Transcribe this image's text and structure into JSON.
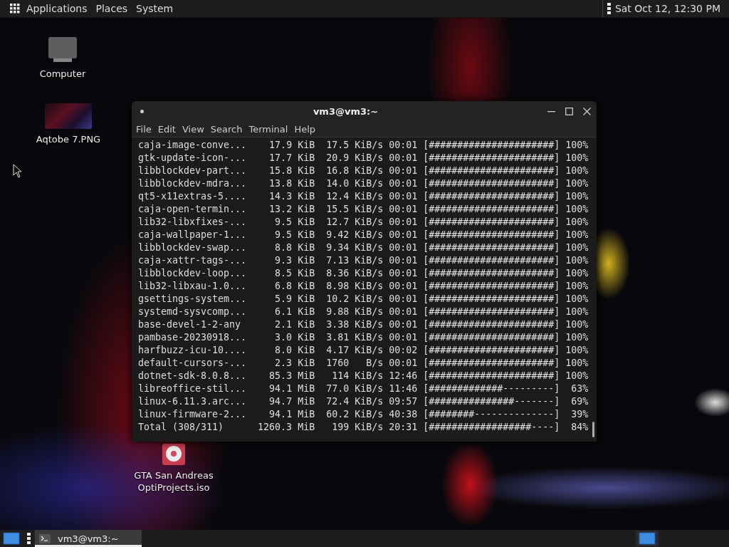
{
  "top_panel": {
    "menus": [
      "Applications",
      "Places",
      "System"
    ],
    "clock": "Sat Oct 12, 12:30 PM"
  },
  "desktop_icons": [
    {
      "label": "Computer",
      "kind": "computer"
    },
    {
      "label": "Aqtobe 7.PNG",
      "kind": "image"
    },
    {
      "label": "GTA San Andreas OptiProjects.iso",
      "kind": "disc"
    }
  ],
  "terminal": {
    "title": "vm3@vm3:~",
    "menu": [
      "File",
      "Edit",
      "View",
      "Search",
      "Terminal",
      "Help"
    ],
    "rows": [
      {
        "name": "caja-image-conve...",
        "size": "17.9 KiB",
        "speed": "17.5 KiB/s",
        "time": "00:01",
        "bar": "[######################]",
        "percent": "100%"
      },
      {
        "name": "gtk-update-icon-...",
        "size": "17.7 KiB",
        "speed": "20.9 KiB/s",
        "time": "00:01",
        "bar": "[######################]",
        "percent": "100%"
      },
      {
        "name": "libblockdev-part...",
        "size": "15.8 KiB",
        "speed": "16.8 KiB/s",
        "time": "00:01",
        "bar": "[######################]",
        "percent": "100%"
      },
      {
        "name": "libblockdev-mdra...",
        "size": "13.8 KiB",
        "speed": "14.0 KiB/s",
        "time": "00:01",
        "bar": "[######################]",
        "percent": "100%"
      },
      {
        "name": "qt5-x11extras-5....",
        "size": "14.3 KiB",
        "speed": "12.4 KiB/s",
        "time": "00:01",
        "bar": "[######################]",
        "percent": "100%"
      },
      {
        "name": "caja-open-termin...",
        "size": "13.2 KiB",
        "speed": "15.5 KiB/s",
        "time": "00:01",
        "bar": "[######################]",
        "percent": "100%"
      },
      {
        "name": "lib32-libxfixes-...",
        "size": "9.5 KiB",
        "speed": "12.7 KiB/s",
        "time": "00:01",
        "bar": "[######################]",
        "percent": "100%"
      },
      {
        "name": "caja-wallpaper-1...",
        "size": "9.5 KiB",
        "speed": "9.42 KiB/s",
        "time": "00:01",
        "bar": "[######################]",
        "percent": "100%"
      },
      {
        "name": "libblockdev-swap...",
        "size": "8.8 KiB",
        "speed": "9.34 KiB/s",
        "time": "00:01",
        "bar": "[######################]",
        "percent": "100%"
      },
      {
        "name": "caja-xattr-tags-...",
        "size": "9.3 KiB",
        "speed": "7.13 KiB/s",
        "time": "00:01",
        "bar": "[######################]",
        "percent": "100%"
      },
      {
        "name": "libblockdev-loop...",
        "size": "8.5 KiB",
        "speed": "8.36 KiB/s",
        "time": "00:01",
        "bar": "[######################]",
        "percent": "100%"
      },
      {
        "name": "lib32-libxau-1.0...",
        "size": "6.8 KiB",
        "speed": "8.98 KiB/s",
        "time": "00:01",
        "bar": "[######################]",
        "percent": "100%"
      },
      {
        "name": "gsettings-system...",
        "size": "5.9 KiB",
        "speed": "10.2 KiB/s",
        "time": "00:01",
        "bar": "[######################]",
        "percent": "100%"
      },
      {
        "name": "systemd-sysvcomp...",
        "size": "6.1 KiB",
        "speed": "9.88 KiB/s",
        "time": "00:01",
        "bar": "[######################]",
        "percent": "100%"
      },
      {
        "name": "base-devel-1-2-any",
        "size": "2.1 KiB",
        "speed": "3.38 KiB/s",
        "time": "00:01",
        "bar": "[######################]",
        "percent": "100%"
      },
      {
        "name": "pambase-20230918...",
        "size": "3.0 KiB",
        "speed": "3.81 KiB/s",
        "time": "00:01",
        "bar": "[######################]",
        "percent": "100%"
      },
      {
        "name": "harfbuzz-icu-10....",
        "size": "8.0 KiB",
        "speed": "4.17 KiB/s",
        "time": "00:02",
        "bar": "[######################]",
        "percent": "100%"
      },
      {
        "name": "default-cursors-...",
        "size": "2.3 KiB",
        "speed": "1760   B/s",
        "time": "00:01",
        "bar": "[######################]",
        "percent": "100%"
      },
      {
        "name": "dotnet-sdk-8.0.8...",
        "size": "85.3 MiB",
        "speed": "114 KiB/s",
        "time": "12:46",
        "bar": "[######################]",
        "percent": "100%"
      },
      {
        "name": "libreoffice-stil...",
        "size": "94.1 MiB",
        "speed": "77.0 KiB/s",
        "time": "11:46",
        "bar": "[#############---------]",
        "percent": "63%"
      },
      {
        "name": "linux-6.11.3.arc...",
        "size": "94.7 MiB",
        "speed": "72.4 KiB/s",
        "time": "09:57",
        "bar": "[###############-------]",
        "percent": "69%"
      },
      {
        "name": "linux-firmware-2...",
        "size": "94.1 MiB",
        "speed": "60.2 KiB/s",
        "time": "40:38",
        "bar": "[########--------------]",
        "percent": "39%"
      },
      {
        "name": "Total (308/311)",
        "size": "1260.3 MiB",
        "speed": "199 KiB/s",
        "time": "20:31",
        "bar": "[##################----]",
        "percent": "84%"
      }
    ]
  },
  "taskbar": {
    "tasks": [
      {
        "label": "vm3@vm3:~",
        "selected": true
      }
    ]
  }
}
